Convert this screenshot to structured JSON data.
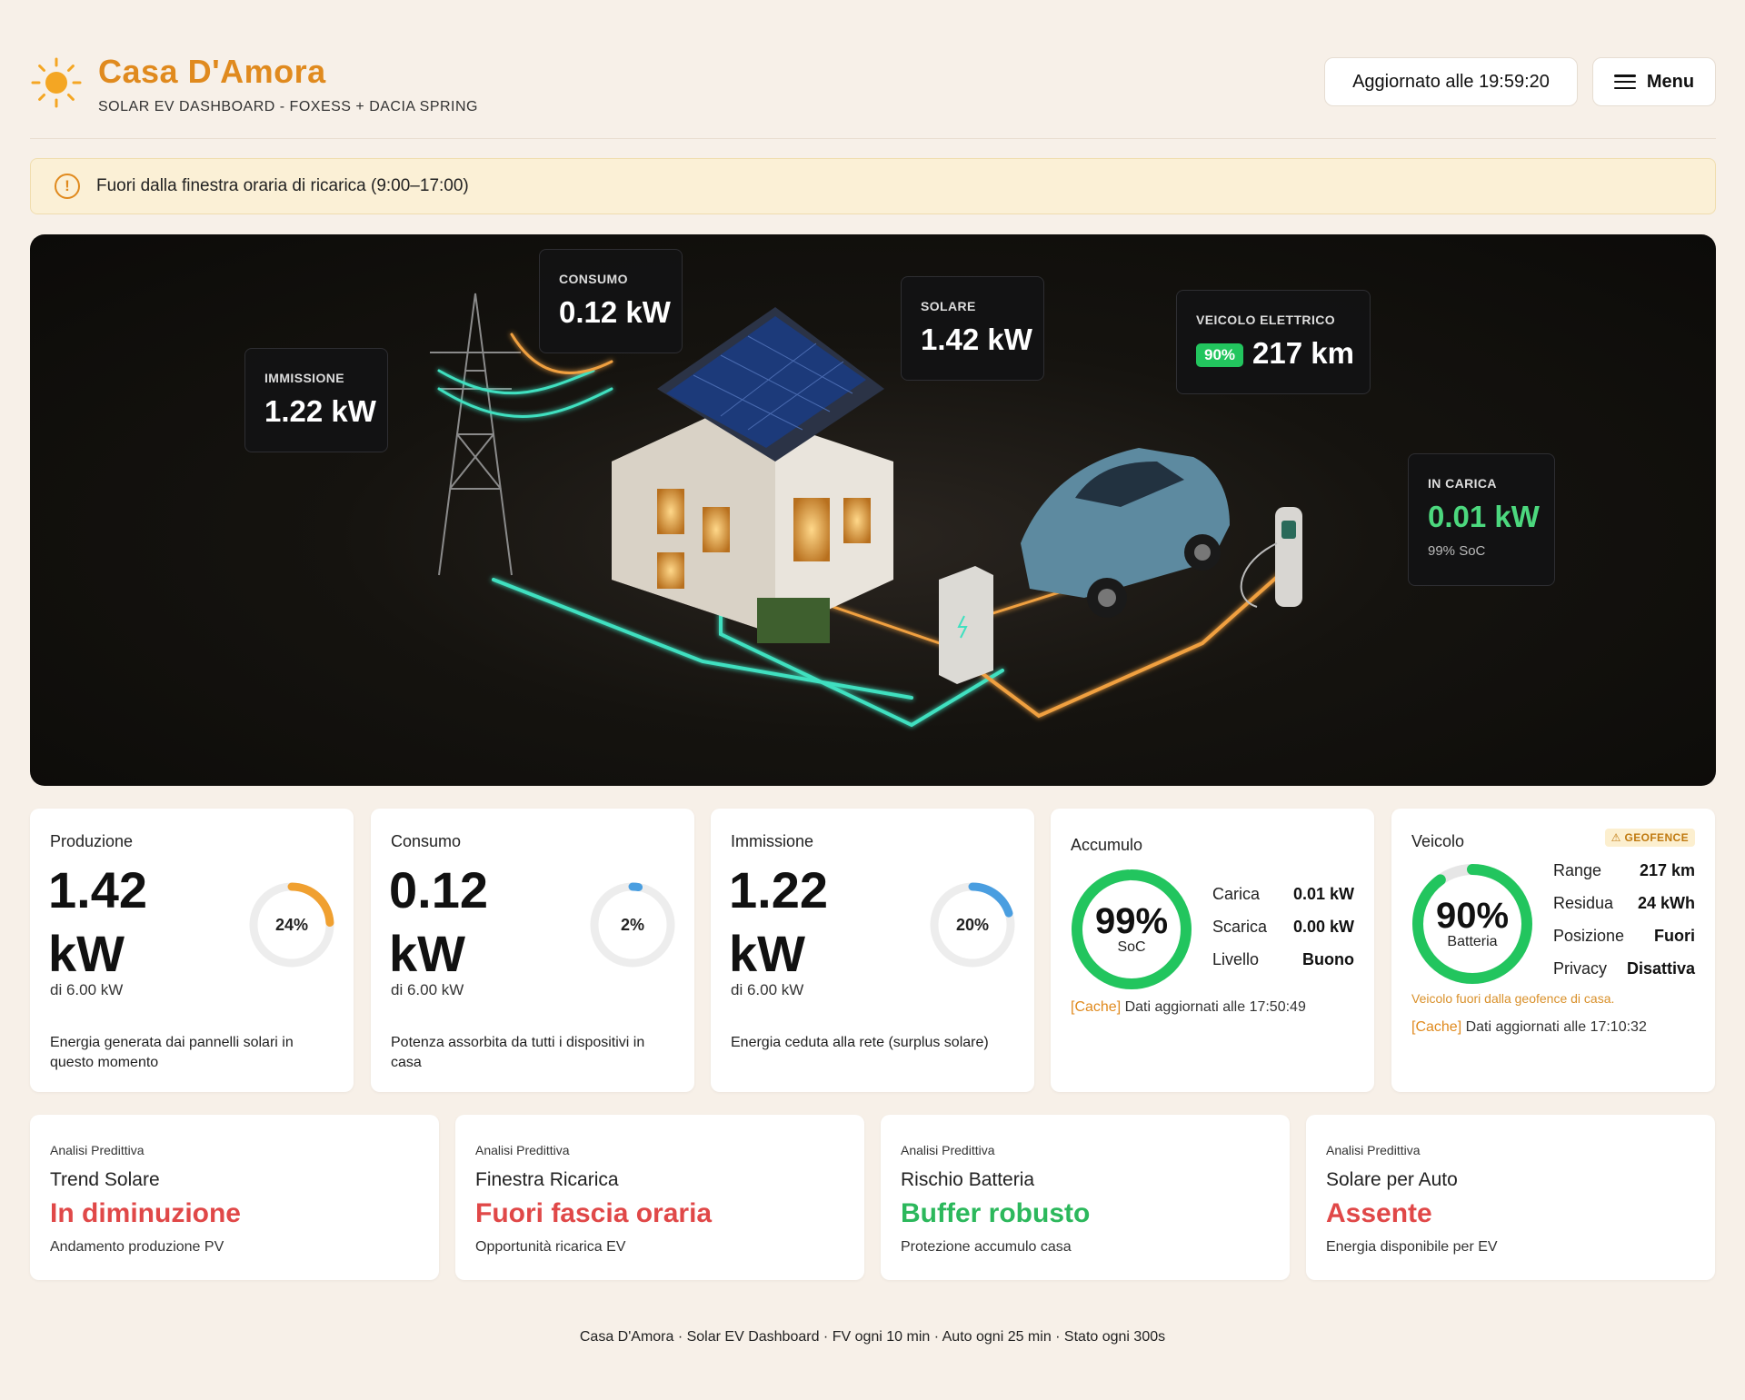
{
  "header": {
    "title": "Casa D'Amora",
    "subtitle": "SOLAR EV DASHBOARD - FOXESS + DACIA SPRING",
    "updated_label": "Aggiornato alle 19:59:20",
    "menu_label": "Menu"
  },
  "alert": {
    "text": "Fuori dalla finestra oraria di ricarica (9:00–17:00)"
  },
  "hero": {
    "immissione": {
      "label": "IMMISSIONE",
      "value": "1.22 kW"
    },
    "consumo": {
      "label": "CONSUMO",
      "value": "0.12 kW"
    },
    "solare": {
      "label": "SOLARE",
      "value": "1.42 kW"
    },
    "veicolo": {
      "label": "VEICOLO ELETTRICO",
      "badge": "90%",
      "value": "217 km"
    },
    "in_carica": {
      "label": "IN CARICA",
      "value": "0.01 kW",
      "sub": "99% SoC"
    }
  },
  "cards": {
    "produzione": {
      "title": "Produzione",
      "value": "1.42 kW",
      "of": "di 6.00 kW",
      "pct_label": "24%",
      "pct": 0.24,
      "color": "#f0a030",
      "desc": "Energia generata dai pannelli solari in questo momento"
    },
    "consumo": {
      "title": "Consumo",
      "value": "0.12 kW",
      "of": "di 6.00 kW",
      "pct_label": "2%",
      "pct": 0.02,
      "color": "#4a9ee0",
      "desc": "Potenza assorbita da tutti i dispositivi in casa"
    },
    "immissione": {
      "title": "Immissione",
      "value": "1.22 kW",
      "of": "di 6.00 kW",
      "pct_label": "20%",
      "pct": 0.2,
      "color": "#4a9ee0",
      "desc": "Energia ceduta alla rete (surplus solare)"
    },
    "accumulo": {
      "title": "Accumulo",
      "pct_label": "99%",
      "ring_label": "SoC",
      "pct": 0.99,
      "rows": [
        {
          "k": "Carica",
          "v": "0.01 kW"
        },
        {
          "k": "Scarica",
          "v": "0.00 kW"
        },
        {
          "k": "Livello",
          "v": "Buono"
        }
      ],
      "cache_tag": "[Cache]",
      "cache_text": "Dati aggiornati alle 17:50:49"
    },
    "veicolo": {
      "title": "Veicolo",
      "geofence": "⚠ GEOFENCE",
      "pct_label": "90%",
      "ring_label": "Batteria",
      "pct": 0.9,
      "rows": [
        {
          "k": "Range",
          "v": "217 km"
        },
        {
          "k": "Residua",
          "v": "24 kWh"
        },
        {
          "k": "Posizione",
          "v": "Fuori"
        },
        {
          "k": "Privacy",
          "v": "Disattiva"
        }
      ],
      "geo_note": "Veicolo fuori dalla geofence di casa.",
      "cache_tag": "[Cache]",
      "cache_text": "Dati aggiornati alle 17:10:32"
    }
  },
  "predictions": [
    {
      "kicker": "Analisi Predittiva",
      "title": "Trend Solare",
      "status": "In diminuzione",
      "desc": "Andamento produzione PV"
    },
    {
      "kicker": "Analisi Predittiva",
      "title": "Finestra Ricarica",
      "status": "Fuori fascia oraria",
      "desc": "Opportunità ricarica EV"
    },
    {
      "kicker": "Analisi Predittiva",
      "title": "Rischio Batteria",
      "status": "Buffer robusto",
      "desc": "Protezione accumulo casa"
    },
    {
      "kicker": "Analisi Predittiva",
      "title": "Solare per Auto",
      "status": "Assente",
      "desc": "Energia disponibile per EV"
    }
  ],
  "footer": "Casa D'Amora · Solar EV Dashboard · FV ogni 10 min · Auto ogni 25 min · Stato ogni 300s",
  "colors": {
    "accent": "#e08a1e",
    "green": "#22c55e",
    "red": "#e04848",
    "blue": "#4a9ee0"
  }
}
